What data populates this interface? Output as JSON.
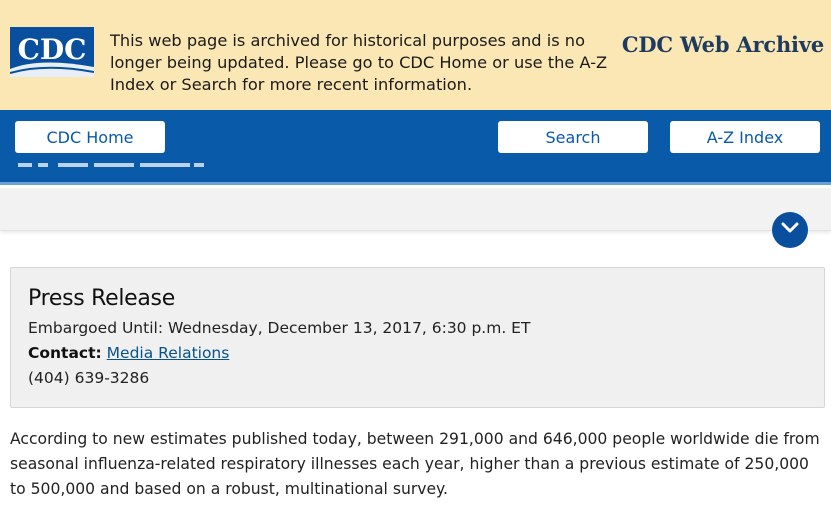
{
  "banner": {
    "logo_text": "CDC",
    "message": "This web page is archived for historical purposes and is no longer being updated. Please go to CDC Home or use the A-Z Index or Search for more recent information.",
    "archive_title": "CDC Web Archive",
    "background_color": "#fbe7b3"
  },
  "nav": {
    "home_label": "CDC Home",
    "search_label": "Search",
    "az_label": "A-Z Index",
    "background_color": "#0a5aaa"
  },
  "expand_button": {
    "icon": "chevron-down-icon"
  },
  "press_release": {
    "title": "Press Release",
    "embargo": "Embargoed Until: Wednesday, December 13, 2017, 6:30 p.m. ET",
    "contact_label": "Contact:",
    "contact_link": "Media Relations",
    "phone": "(404) 639-3286"
  },
  "article": {
    "paragraph": "According to new estimates published today, between 291,000 and 646,000 people worldwide die from seasonal influenza-related respiratory illnesses each year, higher than a previous estimate of 250,000 to 500,000 and based on a robust, multinational survey."
  }
}
